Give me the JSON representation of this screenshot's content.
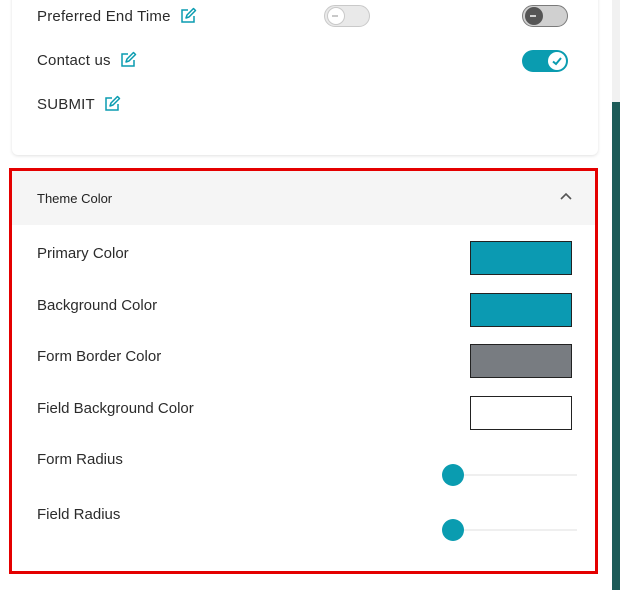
{
  "form_fields": [
    {
      "label": "Preferred End Time",
      "toggle_a": "off",
      "toggle_b": "off"
    },
    {
      "label": "Contact us",
      "toggle_b": "on"
    },
    {
      "label": "SUBMIT"
    }
  ],
  "theme_panel": {
    "title": "Theme Color",
    "colors": [
      {
        "label": "Primary Color",
        "value": "#0b9ab2"
      },
      {
        "label": "Background Color",
        "value": "#0b9ab2"
      },
      {
        "label": "Form Border Color",
        "value": "#787c81"
      },
      {
        "label": "Field Background Color",
        "value": "#ffffff"
      }
    ],
    "sliders": [
      {
        "label": "Form Radius",
        "level": 0
      },
      {
        "label": "Field Radius",
        "level": 0
      }
    ]
  },
  "accent_color": "#0a9cb0",
  "icons": {
    "edit": "edit-icon",
    "collapse": "chevron-up-icon",
    "check": "check-icon"
  }
}
